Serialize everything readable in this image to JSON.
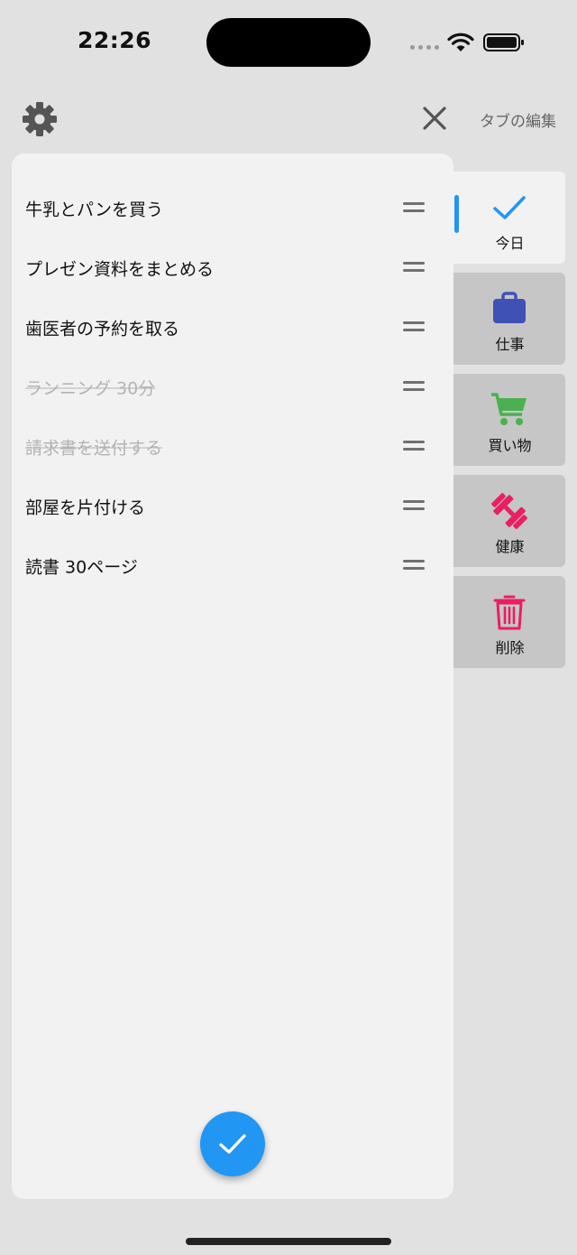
{
  "status_bar": {
    "time": "22:26"
  },
  "header": {
    "settings_icon": "gear-icon",
    "close_icon": "close-icon",
    "edit_tabs_label": "タブの編集"
  },
  "tasks": [
    {
      "text": "牛乳とパンを買う",
      "done": false
    },
    {
      "text": "プレゼン資料をまとめる",
      "done": false
    },
    {
      "text": "歯医者の予約を取る",
      "done": false
    },
    {
      "text": "ランニング 30分",
      "done": true
    },
    {
      "text": "請求書を送付する",
      "done": true
    },
    {
      "text": "部屋を片付ける",
      "done": false
    },
    {
      "text": "読書 30ページ",
      "done": false
    }
  ],
  "tabs": [
    {
      "label": "今日",
      "icon": "check-icon",
      "color": "#2196f3",
      "active": true
    },
    {
      "label": "仕事",
      "icon": "briefcase-icon",
      "color": "#3f51b5",
      "active": false
    },
    {
      "label": "買い物",
      "icon": "cart-icon",
      "color": "#4caf50",
      "active": false
    },
    {
      "label": "健康",
      "icon": "dumbbell-icon",
      "color": "#e91e63",
      "active": false
    },
    {
      "label": "削除",
      "icon": "trash-icon",
      "color": "#e91e63",
      "active": false
    }
  ],
  "fab": {
    "icon": "check-icon",
    "color": "#2196f3"
  },
  "colors": {
    "accent": "#2196f3",
    "background": "#e1e1e1",
    "panel": "#f2f2f2",
    "inactive_tab": "#c6c6c6",
    "done_text": "#b3b3b3"
  }
}
